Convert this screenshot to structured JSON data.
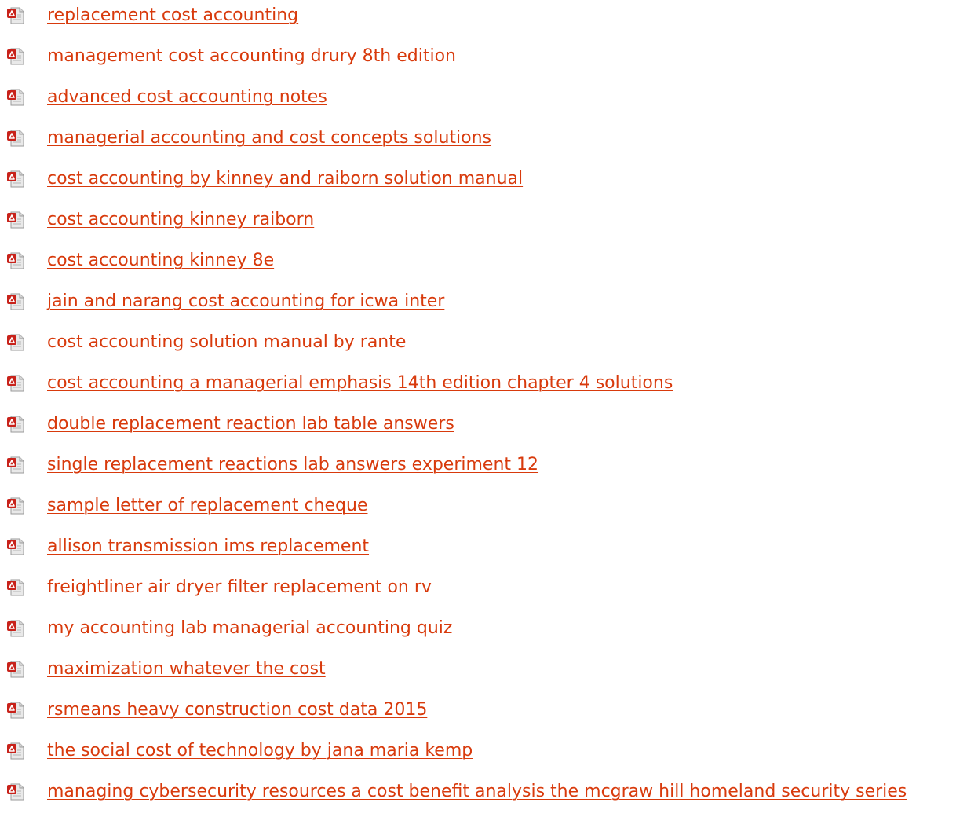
{
  "colors": {
    "link": "#d83a0c",
    "icon_red": "#c8221a",
    "icon_paper": "#e9e9e9"
  },
  "icon_name": "pdf-file-icon",
  "links": [
    {
      "label": "replacement cost accounting"
    },
    {
      "label": "management cost accounting drury 8th edition"
    },
    {
      "label": "advanced cost accounting notes"
    },
    {
      "label": "managerial accounting and cost concepts solutions"
    },
    {
      "label": "cost accounting by kinney and raiborn solution manual"
    },
    {
      "label": "cost accounting kinney raiborn"
    },
    {
      "label": "cost accounting kinney 8e"
    },
    {
      "label": "jain and narang cost accounting for icwa inter"
    },
    {
      "label": "cost accounting solution manual by rante"
    },
    {
      "label": "cost accounting a managerial emphasis 14th edition chapter 4 solutions"
    },
    {
      "label": "double replacement reaction lab table answers"
    },
    {
      "label": "single replacement reactions lab answers experiment 12"
    },
    {
      "label": "sample letter of replacement cheque"
    },
    {
      "label": "allison transmission ims replacement"
    },
    {
      "label": "freightliner air dryer filter replacement on rv"
    },
    {
      "label": "my accounting lab managerial accounting quiz"
    },
    {
      "label": "maximization whatever the cost"
    },
    {
      "label": "rsmeans heavy construction cost data 2015"
    },
    {
      "label": "the social cost of technology by jana maria kemp"
    },
    {
      "label": "managing cybersecurity resources a cost benefit analysis the mcgraw hill homeland security series"
    }
  ]
}
